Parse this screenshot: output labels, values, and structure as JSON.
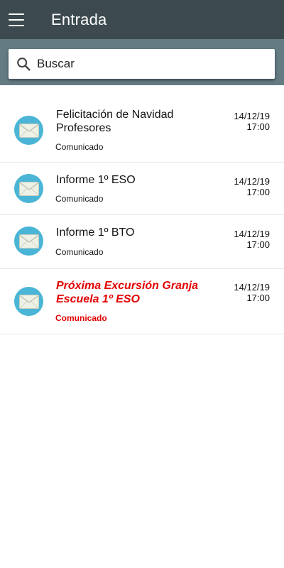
{
  "header": {
    "title": "Entrada",
    "menu_icon": "hamburger-menu-icon"
  },
  "search": {
    "placeholder": "Buscar",
    "value": "",
    "icon": "search-icon"
  },
  "colors": {
    "appbar": "#3c4a4f",
    "search_band": "#647b83",
    "avatar": "#4ab5d6",
    "highlight": "#e20000"
  },
  "messages": [
    {
      "subject": "Felicitación de Navidad Profesores",
      "category": "Comunicado",
      "date": "14/12/19",
      "time": "17:00",
      "highlighted": false,
      "icon": "envelope-icon"
    },
    {
      "subject": "Informe 1º ESO",
      "category": "Comunicado",
      "date": "14/12/19",
      "time": "17:00",
      "highlighted": false,
      "icon": "envelope-icon"
    },
    {
      "subject": "Informe 1º BTO",
      "category": "Comunicado",
      "date": "14/12/19",
      "time": "17:00",
      "highlighted": false,
      "icon": "envelope-icon"
    },
    {
      "subject": "Próxima Excursión Granja Escuela 1º ESO",
      "category": "Comunicado",
      "date": "14/12/19",
      "time": "17:00",
      "highlighted": true,
      "icon": "envelope-icon"
    }
  ]
}
